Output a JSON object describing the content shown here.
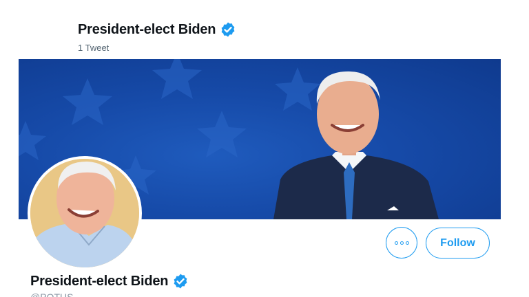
{
  "header": {
    "display_name": "President-elect Biden",
    "tweet_count": "1 Tweet",
    "verified_icon": "verified-badge-icon"
  },
  "profile": {
    "display_name": "President-elect Biden",
    "handle": "@POTUS",
    "verified_icon": "verified-badge-icon"
  },
  "actions": {
    "more_icon": "more-options-icon",
    "follow_label": "Follow"
  },
  "colors": {
    "accent": "#1d9bf0",
    "banner_blue": "#164aa8",
    "avatar_background": "#e9c786"
  }
}
